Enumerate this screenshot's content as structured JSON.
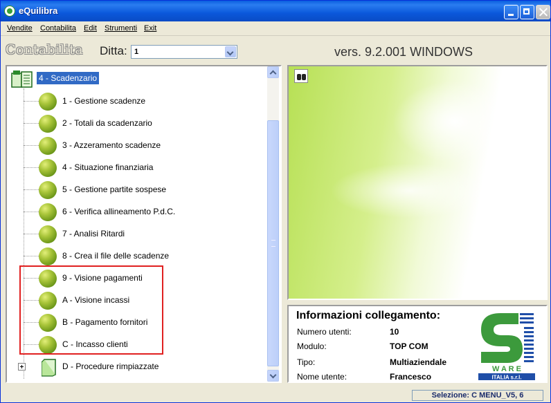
{
  "window": {
    "title": "eQuilibra"
  },
  "menu": [
    "Vendite",
    "Contabilita",
    "Edit",
    "Strumenti",
    "Exit"
  ],
  "header": {
    "section": "Contabilita",
    "ditta_label": "Ditta:",
    "ditta_value": "1",
    "version": "vers. 9.2.001 WINDOWS"
  },
  "tree": {
    "root_label": "4 - Scadenzario",
    "items": [
      {
        "label": "1 - Gestione scadenze"
      },
      {
        "label": "2 - Totali da scadenzario"
      },
      {
        "label": "3 - Azzeramento scadenze"
      },
      {
        "label": "4 - Situazione finanziaria"
      },
      {
        "label": "5 - Gestione partite sospese"
      },
      {
        "label": "6 - Verifica allineamento P.d.C."
      },
      {
        "label": "7 - Analisi Ritardi"
      },
      {
        "label": "8 - Crea il file delle scadenze"
      },
      {
        "label": "9 - Visione pagamenti"
      },
      {
        "label": "A - Visione incassi"
      },
      {
        "label": "B - Pagamento fornitori"
      },
      {
        "label": "C - Incasso clienti"
      }
    ],
    "collapsed_item": {
      "label": "D - Procedure rimpiazzate"
    }
  },
  "info": {
    "title": "Informazioni collegamento:",
    "rows": [
      {
        "key": "Numero utenti:",
        "value": "10"
      },
      {
        "key": "Modulo:",
        "value": "TOP COM"
      },
      {
        "key": "Tipo:",
        "value": "Multiaziendale"
      },
      {
        "key": "Nome utente:",
        "value": "Francesco"
      }
    ]
  },
  "logo": {
    "line1": "W A R E",
    "line2": "ITALIA s.r.l."
  },
  "status": {
    "selection": "Selezione: C MENU_V5, 6"
  },
  "colors": {
    "selection": "#316ac5",
    "highlight_box": "#e02020",
    "titlebar": "#0a5fe0",
    "logo_green": "#3c9a3c",
    "logo_blue": "#1f4ea8"
  }
}
